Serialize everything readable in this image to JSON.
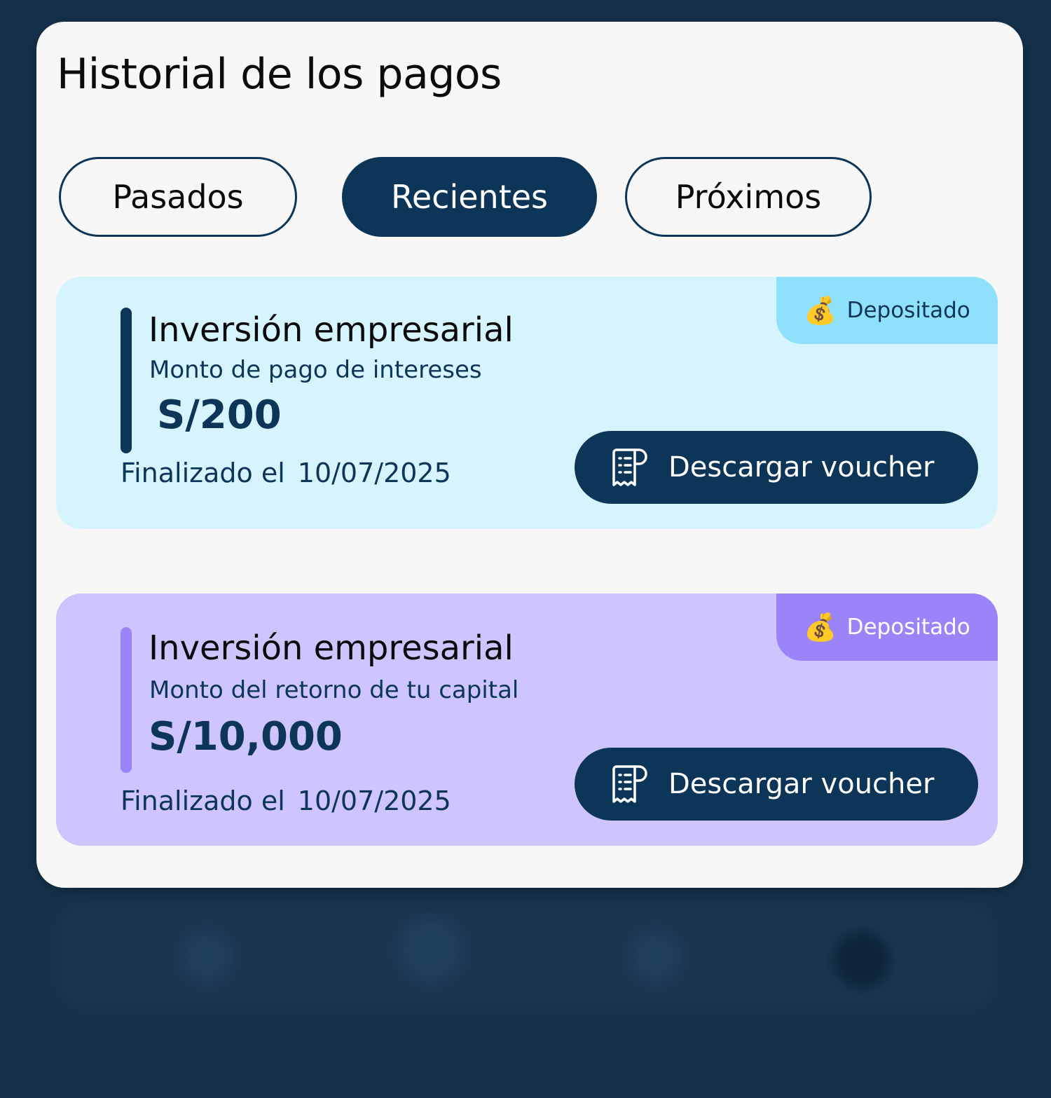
{
  "header": {
    "title": "Historial de los pagos"
  },
  "tabs": [
    {
      "label": "Pasados",
      "active": false
    },
    {
      "label": "Recientes",
      "active": true
    },
    {
      "label": "Próximos",
      "active": false
    }
  ],
  "payments": [
    {
      "title": "Inversión empresarial",
      "subtitle": "Monto de pago de intereses",
      "amount": "S/200",
      "finalized_label": "Finalizado el",
      "date": "10/07/2025",
      "status": "Depositado",
      "status_icon": "money-bag-icon",
      "button_label": "Descargar voucher",
      "button_icon": "receipt-icon",
      "accent": "#0d3557",
      "background": "#d5f4fe"
    },
    {
      "title": "Inversión empresarial",
      "subtitle": "Monto del retorno de tu capital",
      "amount": "S/10,000",
      "finalized_label": "Finalizado el",
      "date": "10/07/2025",
      "status": "Depositado",
      "status_icon": "money-bag-icon",
      "button_label": "Descargar voucher",
      "button_icon": "receipt-icon",
      "accent": "#9b84fa",
      "background": "#cec5ff"
    }
  ],
  "colors": {
    "primary": "#0d3557",
    "page_background": "#15304a",
    "modal_background": "#f7f7f7"
  }
}
